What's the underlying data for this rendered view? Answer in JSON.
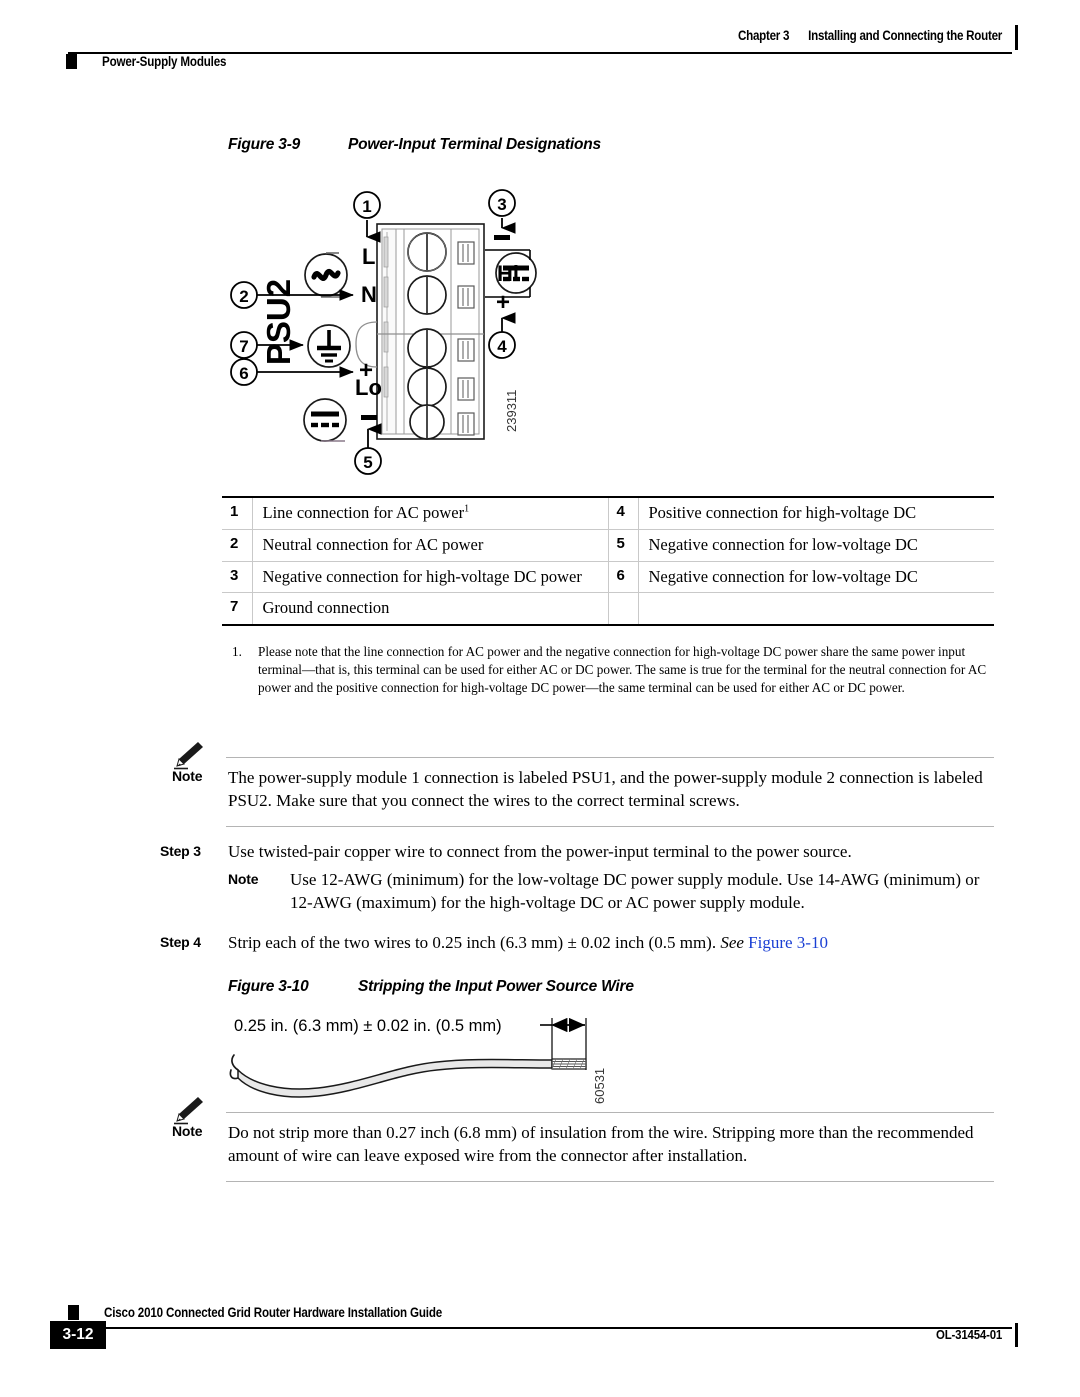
{
  "header": {
    "chapter": "Chapter 3",
    "chapter_title": "Installing and Connecting the Router",
    "section": "Power-Supply Modules"
  },
  "figure_3_9": {
    "number": "Figure 3-9",
    "title": "Power-Input Terminal Designations",
    "graphic_id": "239311",
    "module_label": "PSU2",
    "terminal_labels": {
      "line": "L",
      "neutral": "N",
      "high_plus": "+",
      "high_minus": "–",
      "low_plus": "+",
      "low_minus": "–",
      "high_group": "Hi",
      "low_group": "Lo"
    },
    "callouts": [
      "1",
      "2",
      "3",
      "4",
      "5",
      "6",
      "7"
    ],
    "symbols": {
      "ac": "ac-sine-symbol",
      "ground": "earth-ground-symbol",
      "dc": "dc-symbol"
    }
  },
  "legend_table": {
    "rows": [
      {
        "num": "1",
        "text": "Line connection for AC power",
        "footnote": "1",
        "num2": "4",
        "text2": "Positive connection for high-voltage DC"
      },
      {
        "num": "2",
        "text": "Neutral connection for AC power",
        "footnote": "",
        "num2": "5",
        "text2": "Negative connection for low-voltage DC"
      },
      {
        "num": "3",
        "text": "Negative connection for high-voltage DC power",
        "footnote": "",
        "num2": "6",
        "text2": "Negative connection for low-voltage DC"
      },
      {
        "num": "7",
        "text": "Ground connection",
        "footnote": "",
        "num2": "",
        "text2": ""
      }
    ]
  },
  "footnote": {
    "marker": "1.",
    "text": "Please note that the line connection for AC power and the negative connection for high-voltage DC power share the same power input terminal—that is, this terminal can be used for either AC or DC power. The same is true for the terminal for the neutral connection for AC power and the positive connection for high-voltage DC power—the same terminal can be used for either AC or DC power."
  },
  "note_1": {
    "label": "Note",
    "text": "The power-supply module 1 connection is labeled PSU1, and the power-supply module 2 connection is labeled PSU2. Make sure that you connect the wires to the correct terminal screws."
  },
  "step_3": {
    "label": "Step 3",
    "text": "Use twisted-pair copper wire to connect from the power-input terminal to the power source."
  },
  "note_2": {
    "label": "Note",
    "text": "Use 12-AWG (minimum) for the low-voltage DC power supply module. Use 14-AWG (minimum) or 12-AWG (maximum) for the high-voltage DC or AC power supply module."
  },
  "step_4": {
    "label": "Step 4",
    "text_before": "Strip each of the two wires to 0.25 inch (6.3 mm) ± 0.02 inch (0.5 mm). ",
    "see": "See",
    "link": "Figure 3-10"
  },
  "figure_3_10": {
    "number": "Figure 3-10",
    "title": "Stripping the Input Power Source Wire",
    "dimension_label": "0.25 in. (6.3 mm) ± 0.02 in. (0.5 mm)",
    "graphic_id": "60531"
  },
  "note_3": {
    "label": "Note",
    "text": "Do not strip more than 0.27 inch (6.8 mm) of insulation from the wire. Stripping more than the recommended amount of wire can leave exposed wire from the connector after installation."
  },
  "footer": {
    "page_number": "3-12",
    "guide_title": "Cisco 2010  Connected Grid Router Hardware Installation Guide",
    "doc_number": "OL-31454-01"
  },
  "colors": {
    "link": "#1a3fd4",
    "rule": "#000000",
    "table_rule": "#c9c9c9",
    "note_rule": "#b4b4b4",
    "wire_fill": "#e8e8e8"
  }
}
